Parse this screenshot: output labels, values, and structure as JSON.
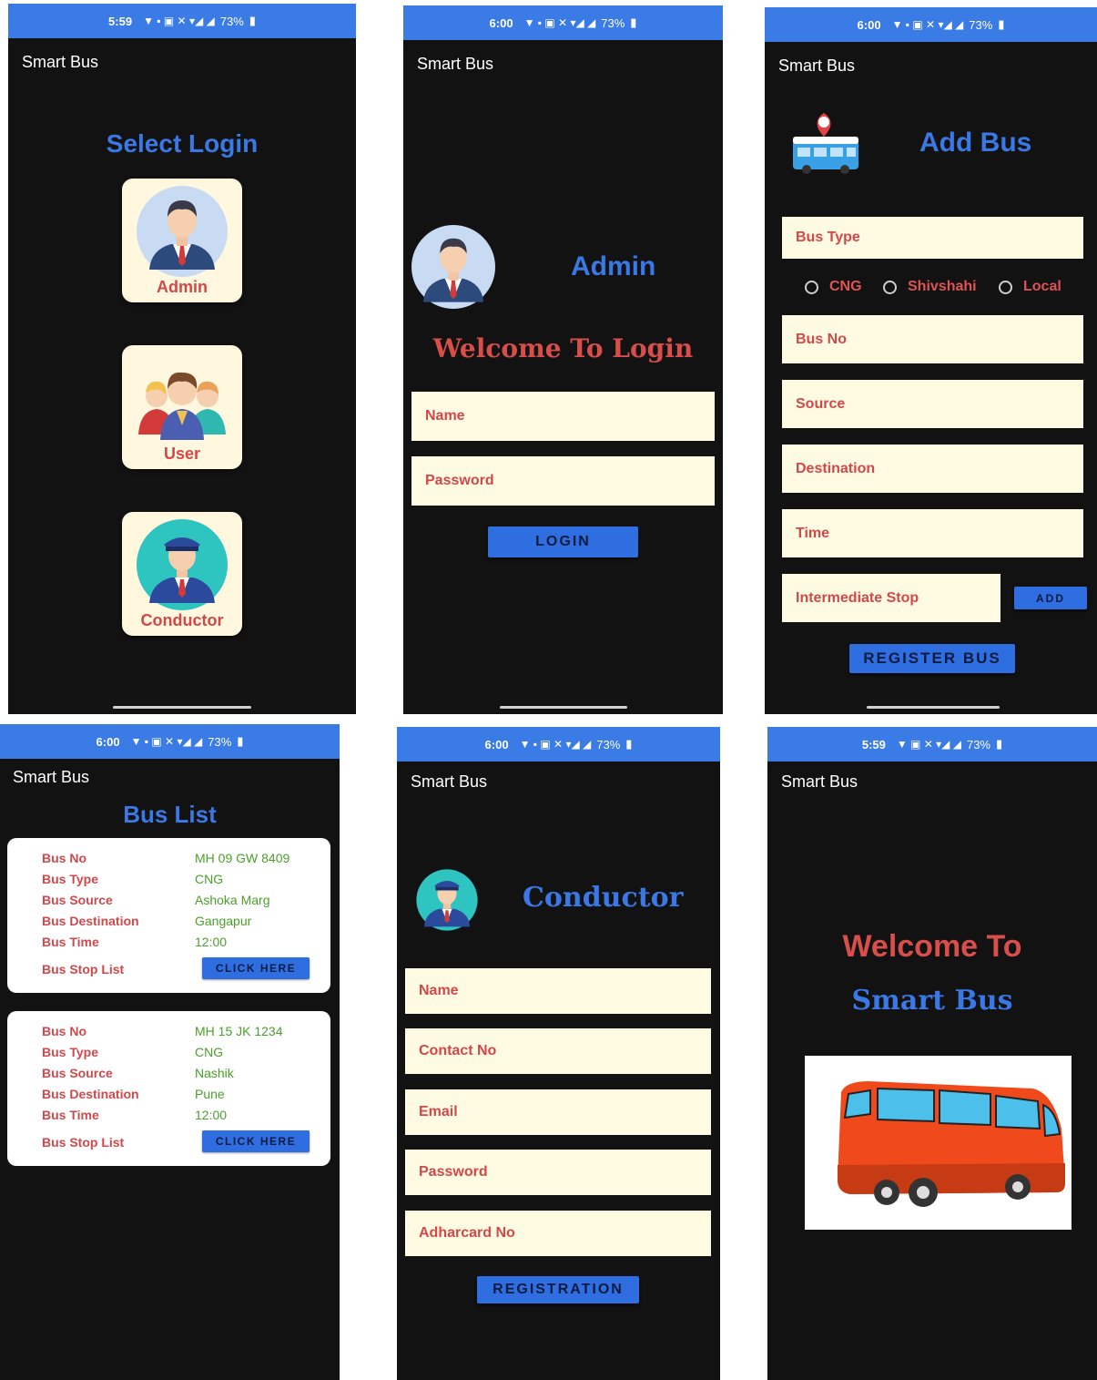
{
  "app_title": "Smart Bus",
  "status": {
    "s1_time": "5:59",
    "s2_time": "6:00",
    "s3_time": "6:00",
    "s4_time": "6:00",
    "s5_time": "6:00",
    "s6_time": "5:59",
    "battery": "73%"
  },
  "select_login": {
    "title": "Select Login",
    "options": [
      "Admin",
      "User",
      "Conductor"
    ]
  },
  "admin_login": {
    "role": "Admin",
    "welcome": "Welcome To Login",
    "name_placeholder": "Name",
    "password_placeholder": "Password",
    "login_label": "LOGIN"
  },
  "add_bus": {
    "title": "Add Bus",
    "bus_type_label": "Bus Type",
    "radio_options": [
      "CNG",
      "Shivshahi",
      "Local"
    ],
    "bus_no": "Bus No",
    "source": "Source",
    "destination": "Destination",
    "time": "Time",
    "intermediate_stop": "Intermediate Stop",
    "add_label": "ADD",
    "register_label": "REGISTER BUS"
  },
  "bus_list": {
    "title": "Bus List",
    "field_labels": [
      "Bus No",
      "Bus Type",
      "Bus Source",
      "Bus Destination",
      "Bus Time",
      "Bus Stop List"
    ],
    "button_label": "CLICK HERE",
    "buses": [
      {
        "no": "MH 09 GW 8409",
        "type": "CNG",
        "source": "Ashoka Marg",
        "destination": "Gangapur",
        "time": "12:00"
      },
      {
        "no": "MH 15 JK 1234",
        "type": "CNG",
        "source": "Nashik",
        "destination": "Pune",
        "time": "12:00"
      }
    ]
  },
  "conductor_reg": {
    "role": "Conductor",
    "name": "Name",
    "contact": "Contact No",
    "email": "Email",
    "password": "Password",
    "adhar": "Adharcard No",
    "register_label": "REGISTRATION"
  },
  "splash": {
    "line1": "Welcome To",
    "line2": "Smart Bus"
  },
  "colors": {
    "status_bar": "#3a7be6",
    "background": "#121212",
    "accent_blue": "#3a78e6",
    "accent_red": "#d84e4a",
    "field_bg": "#fffbe3"
  }
}
